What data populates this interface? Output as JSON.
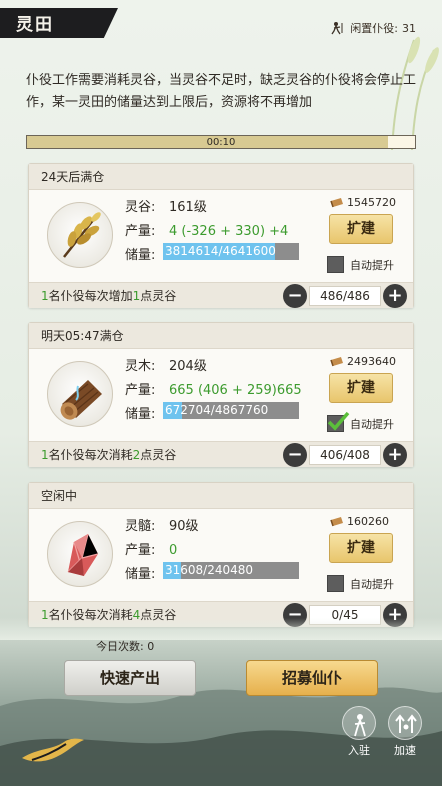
{
  "header": {
    "title": "灵田",
    "idle_label": "闲置仆役:",
    "idle_count": "31"
  },
  "description": "仆役工作需要消耗灵谷，当灵谷不足时，缺乏灵谷的仆役将会停止工作，某一灵田的储量达到上限后，资源将不再增加",
  "timer": {
    "text": "00:10",
    "progress": 0.93
  },
  "cards": [
    {
      "status": "24天后满仓",
      "icon": "grain-icon",
      "name_label": "灵谷:",
      "level": "161级",
      "prod_label": "产量:",
      "prod_value": "4 (-326 + 330) +4",
      "store_label": "储量:",
      "store_text": "3814614/4641600",
      "store_ratio": 0.82,
      "cost": "1545720",
      "build_label": "扩建",
      "auto_label": "自动提升",
      "auto_checked": false,
      "foot_prefix": "1",
      "foot_mid": "名仆役每次增加",
      "foot_num": "1",
      "foot_suffix": "点灵谷",
      "stepper_value": "486/486"
    },
    {
      "status": "明天05:47满仓",
      "icon": "wood-log-icon",
      "name_label": "灵木:",
      "level": "204级",
      "prod_label": "产量:",
      "prod_value": "665 (406 + 259)",
      "prod_extra": "665",
      "store_label": "储量:",
      "store_text": "672704/4867760",
      "store_ratio": 0.14,
      "cost": "2493640",
      "build_label": "扩建",
      "auto_label": "自动提升",
      "auto_checked": true,
      "foot_prefix": "1",
      "foot_mid": "名仆役每次消耗",
      "foot_num": "2",
      "foot_suffix": "点灵谷",
      "stepper_value": "406/408"
    },
    {
      "status": "空闲中",
      "icon": "crystal-icon",
      "name_label": "灵髓:",
      "level": "90级",
      "prod_label": "产量:",
      "prod_value": "0",
      "store_label": "储量:",
      "store_text": "31608/240480",
      "store_ratio": 0.13,
      "cost": "160260",
      "build_label": "扩建",
      "auto_label": "自动提升",
      "auto_checked": false,
      "foot_prefix": "1",
      "foot_mid": "名仆役每次消耗",
      "foot_num": "4",
      "foot_suffix": "点灵谷",
      "stepper_value": "0/45"
    }
  ],
  "today_label": "今日次数:",
  "today_count": "0",
  "buttons": {
    "quick_produce": "快速产出",
    "recruit": "招募仙仆"
  },
  "side_actions": {
    "station": "入驻",
    "speed_up": "加速"
  }
}
